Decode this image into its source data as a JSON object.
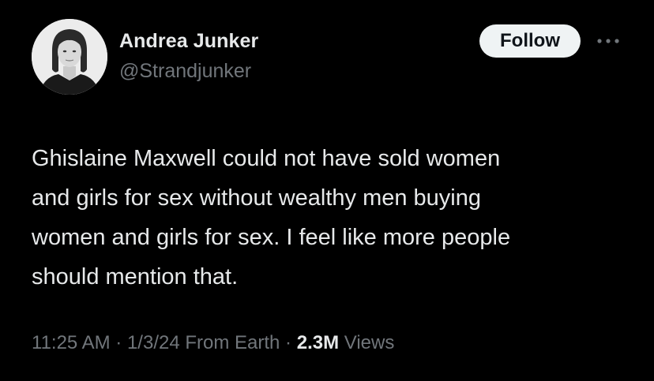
{
  "author": {
    "display_name": "Andrea Junker",
    "handle": "@Strandjunker",
    "avatar_icon": "profile-photo"
  },
  "actions": {
    "follow_label": "Follow",
    "more_icon": "more-horizontal-icon"
  },
  "tweet": {
    "text": "Ghislaine Maxwell could not have sold women\nand girls for sex without wealthy men buying\nwomen and girls for sex. I feel like more people\nshould mention that."
  },
  "meta": {
    "time": "11:25 AM",
    "separator": " · ",
    "date": "1/3/24",
    "location": "From Earth",
    "views_count": "2.3M",
    "views_label": "Views"
  },
  "colors": {
    "background": "#000000",
    "primary_text": "#e7e9ea",
    "secondary_text": "#71767b",
    "follow_button_bg": "#eff3f4",
    "follow_button_text": "#0f1419"
  }
}
